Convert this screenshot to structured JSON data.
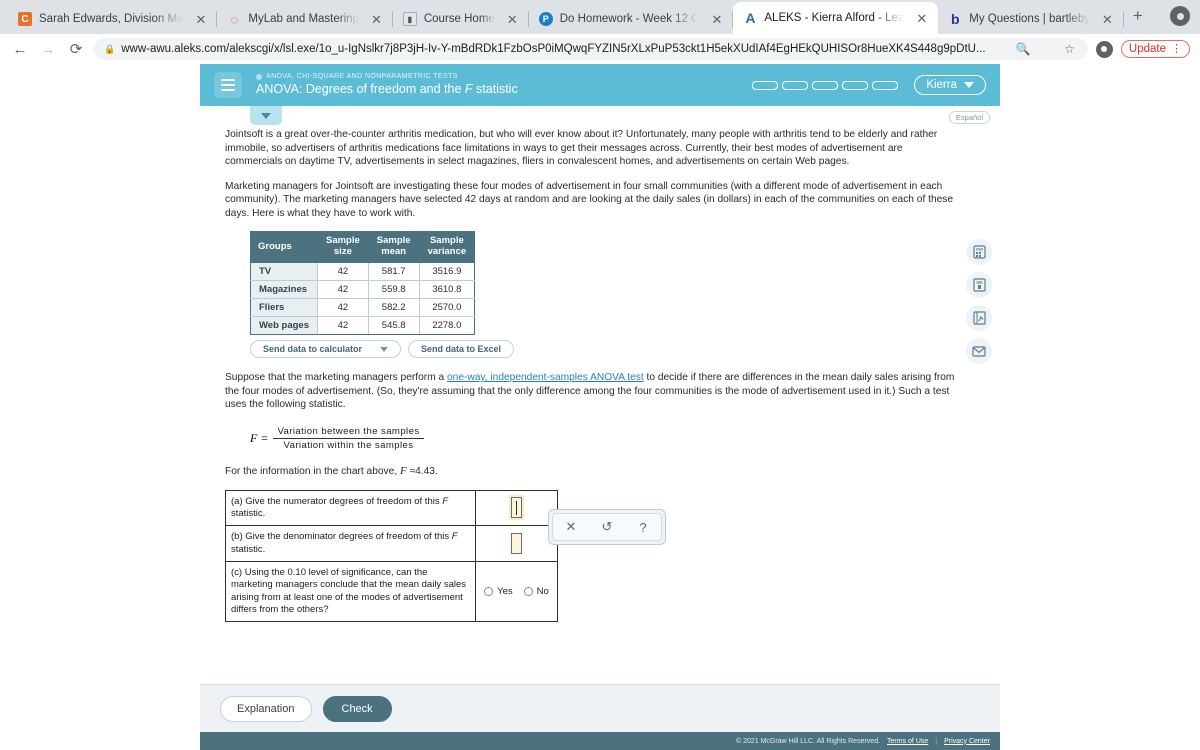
{
  "browser": {
    "tabs": [
      {
        "title": "Sarah Edwards, Division Ma",
        "favicon": "canvas-icon",
        "glyph": "C",
        "active": false
      },
      {
        "title": "MyLab and Mastering",
        "favicon": "mylab-icon",
        "glyph": "◌",
        "active": false
      },
      {
        "title": "Course Home",
        "favicon": "course-icon",
        "glyph": "▮",
        "active": false
      },
      {
        "title": "Do Homework - Week 12 C",
        "favicon": "pearson-icon",
        "glyph": "P",
        "active": false
      },
      {
        "title": "ALEKS - Kierra Alford - Lea",
        "favicon": "aleks-icon",
        "glyph": "A",
        "active": true
      },
      {
        "title": "My Questions | bartleby",
        "favicon": "bartleby-icon",
        "glyph": "b",
        "active": false
      }
    ],
    "new_tab_label": "+",
    "close_label": "✕",
    "back_label": "←",
    "forward_label": "→",
    "reload_label": "⟳",
    "lock_label": "🔒",
    "url": "www-awu.aleks.com/alekscgi/x/lsl.exe/1o_u-IgNslkr7j8P3jH-Iv-Y-mBdRDk1FzbOsP0iMQwqFYZIN5rXLxPuP53ckt1H5ekXUdIAf4EgHEkQUHISOr8HueXK4S448g9pDtU...",
    "zoom_icon": "🔍",
    "bookmark_icon": "☆",
    "update_label": "Update",
    "menu_dots": "⋮"
  },
  "app": {
    "header": {
      "menu_icon": "hamburger-icon",
      "eyebrow": "ANOVA, CHI-SQUARE AND NONPARAMETRIC TESTS",
      "title_prefix": "ANOVA: Degrees of freedom and the ",
      "title_var": "F",
      "title_suffix": " statistic",
      "progress_pills": 5,
      "user_name": "Kierra"
    },
    "espanol_label": "Español",
    "rail_icons": [
      {
        "name": "calculator-icon"
      },
      {
        "name": "reference-table-icon"
      },
      {
        "name": "graph-notebook-icon"
      },
      {
        "name": "message-icon"
      }
    ],
    "paragraphs": {
      "intro": "Jointsoft is a great over-the-counter arthritis medication, but who will ever know about it? Unfortunately, many people with arthritis tend to be elderly and rather immobile, so advertisers of arthritis medications face limitations in ways to get their messages across. Currently, their best modes of advertisement are commercials on daytime TV, advertisements in select magazines, fliers in convalescent homes, and advertisements on certain Web pages.",
      "setup": "Marketing managers for Jointsoft are investigating these four modes of advertisement in four small communities (with a different mode of advertisement in each community). The marketing managers have selected 42 days at random and are looking at the daily sales (in dollars) in each of the communities on each of these days. Here is what they have to work with.",
      "suppose_a": "Suppose that the marketing managers perform a ",
      "suppose_link": "one-way, independent-samples ANOVA test",
      "suppose_b": " to decide if there are differences in the mean daily sales arising from the four modes of advertisement. (So, they're assuming that the only difference among the four communities is the mode of advertisement used in it.) Such a test uses the following statistic.",
      "f_value_a": "For the information in the chart above, ",
      "f_value_var": "F",
      "f_value_b": " ≈4.43."
    },
    "formula": {
      "lhs": "F =",
      "numerator": "Variation between the samples",
      "denominator": "Variation within the samples"
    },
    "table": {
      "headers": [
        "Groups",
        "Sample size",
        "Sample mean",
        "Sample variance"
      ],
      "header_lines": [
        [
          "Groups"
        ],
        [
          "Sample",
          "size"
        ],
        [
          "Sample",
          "mean"
        ],
        [
          "Sample",
          "variance"
        ]
      ],
      "rows": [
        {
          "group": "TV",
          "size": "42",
          "mean": "581.7",
          "variance": "3516.9"
        },
        {
          "group": "Magazines",
          "size": "42",
          "mean": "559.8",
          "variance": "3610.8"
        },
        {
          "group": "Fliers",
          "size": "42",
          "mean": "582.2",
          "variance": "2570.0"
        },
        {
          "group": "Web pages",
          "size": "42",
          "mean": "545.8",
          "variance": "2278.0"
        }
      ]
    },
    "data_buttons": {
      "calculator": "Send data to calculator",
      "excel": "Send data to Excel"
    },
    "questions": [
      {
        "label": "(a)",
        "text_a": "Give the numerator degrees of freedom of this ",
        "text_var": "F",
        "text_b": " statistic.",
        "answer_type": "input",
        "value": ""
      },
      {
        "label": "(b)",
        "text_a": "Give the denominator degrees of freedom of this ",
        "text_var": "F",
        "text_b": " statistic.",
        "answer_type": "input",
        "value": ""
      },
      {
        "label": "(c)",
        "text_a": "Using the 0.10 level of significance, can the marketing managers conclude that the mean daily sales arising from at least one of the modes of advertisement differs from the others?",
        "text_var": "",
        "text_b": "",
        "answer_type": "radio",
        "options": [
          "Yes",
          "No"
        ]
      }
    ],
    "palette": {
      "clear_label": "✕",
      "undo_label": "↺",
      "help_label": "?"
    },
    "footer": {
      "explanation_label": "Explanation",
      "check_label": "Check",
      "copyright": "© 2021 McGraw Hill LLC. All Rights Reserved.",
      "terms_label": "Terms of Use",
      "divider": "|",
      "privacy_label": "Privacy Center"
    }
  },
  "colors": {
    "header_teal": "#5cbcd6",
    "table_header": "#4c717f",
    "link_blue": "#2a7fb5",
    "input_yellow": "#fdf6cf",
    "input_border": "#5b63c9",
    "update_red": "#d93025"
  }
}
